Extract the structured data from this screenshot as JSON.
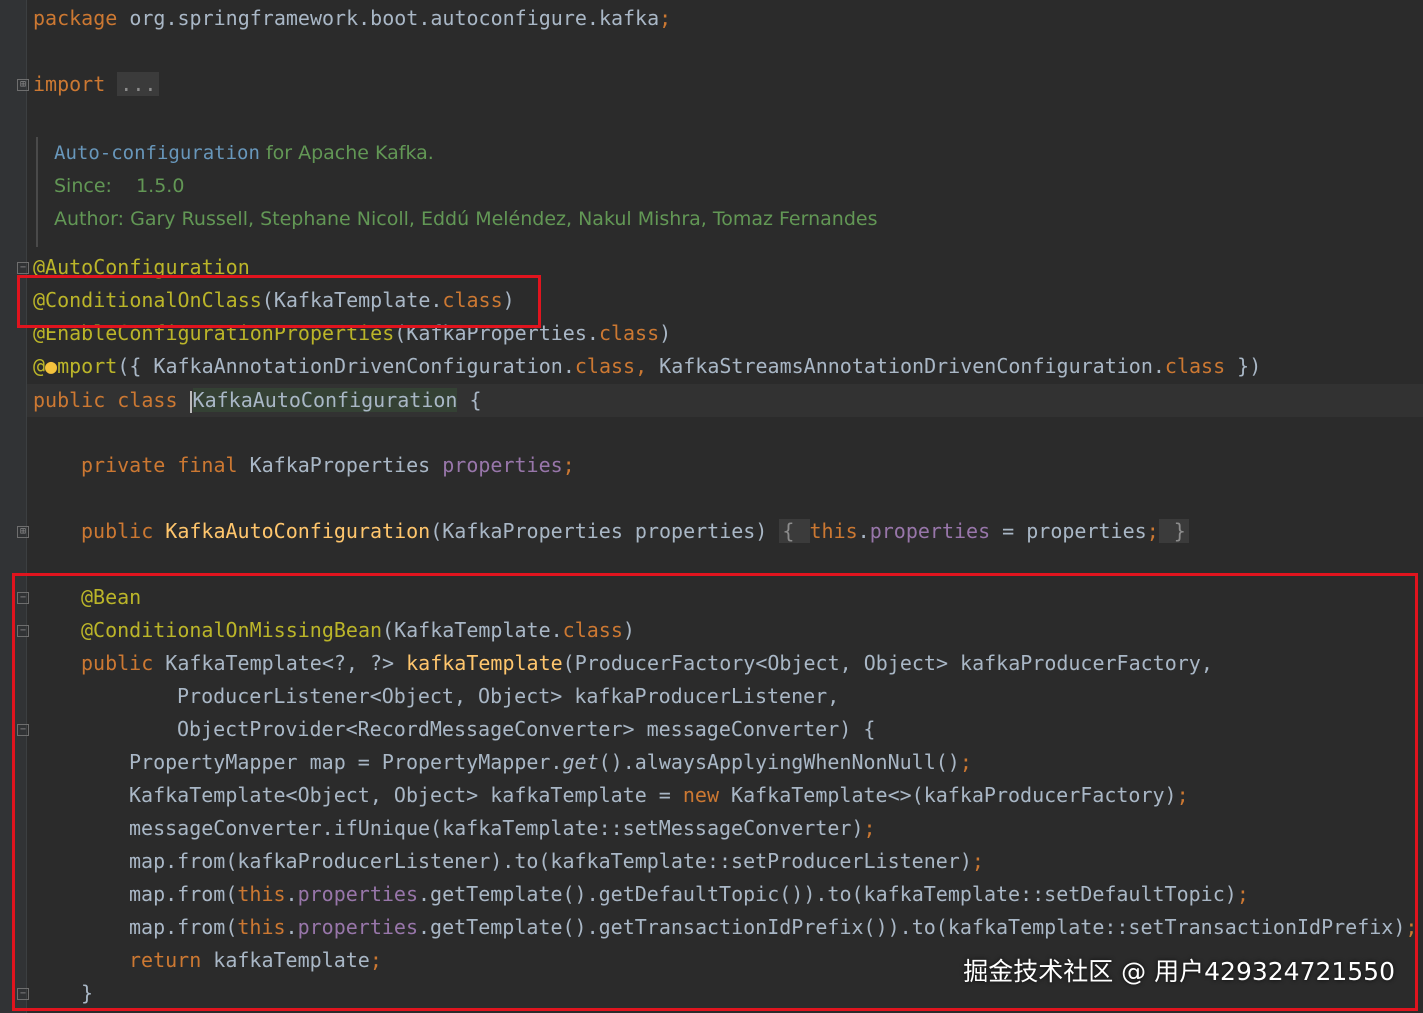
{
  "code": {
    "package_line": {
      "kw": "package",
      "name": " org.springframework.boot.autoconfigure.kafka",
      "semi": ";"
    },
    "import_line": {
      "kw": "import",
      "folded": "..."
    },
    "javadoc": {
      "summary_link": "Auto-configuration",
      "summary_rest": " for Apache Kafka.",
      "since_label": "Since:",
      "since_value": "1.5.0",
      "author_label": "Author:",
      "author_value": "Gary Russell, Stephane Nicoll, Eddú Meléndez, Nakul Mishra, Tomaz Fernandes"
    },
    "ann_autoconfig": "@AutoConfiguration",
    "ann_conditional": {
      "ann": "@ConditionalOnClass",
      "open": "(KafkaTemplate.",
      "kw": "class",
      "close": ")"
    },
    "ann_enable": {
      "ann": "@EnableConfigurationProperties",
      "open": "(KafkaProperties.",
      "kw": "class",
      "close": ")"
    },
    "ann_import": {
      "at": "@",
      "ann_rest": "mport",
      "p1": "({ KafkaAnnotationDrivenConfiguration.",
      "kw1": "class",
      "comma": ",",
      "p2": " KafkaStreamsAnnotationDrivenConfiguration.",
      "kw2": "class",
      "close": " })"
    },
    "class_decl": {
      "kw": "public class ",
      "name": "KafkaAutoConfiguration",
      "brace": " {"
    },
    "field_line": {
      "kw": "private final ",
      "type": "KafkaProperties ",
      "name": "properties",
      "semi": ";"
    },
    "ctor_line": {
      "kw": "public ",
      "name": "KafkaAutoConfiguration",
      "params": "(KafkaProperties properties) ",
      "body_open": "{ ",
      "this_kw": "this",
      "dot": ".",
      "field": "properties",
      "assign": " = properties",
      "semi": ";",
      "body_close": " }"
    },
    "bean_ann": "@Bean",
    "missing_bean": {
      "ann": "@ConditionalOnMissingBean",
      "open": "(KafkaTemplate.",
      "kw": "class",
      "close": ")"
    },
    "method_decl": {
      "kw": "public ",
      "ret": "KafkaTemplate<?, ?> ",
      "name": "kafkaTemplate",
      "params": "(ProducerFactory<Object, Object> kafkaProducerFactory,"
    },
    "method_param2": "ProducerListener<Object, Object> kafkaProducerListener,",
    "method_param3": "ObjectProvider<RecordMessageConverter> messageConverter) {",
    "body1": {
      "pre": "PropertyMapper map = PropertyMapper.",
      "ital": "get",
      "post": "().alwaysApplyingWhenNonNull()",
      "semi": ";"
    },
    "body2": {
      "pre": "KafkaTemplate<Object, Object> kafkaTemplate = ",
      "kw": "new",
      "post": " KafkaTemplate<>(kafkaProducerFactory)",
      "semi": ";"
    },
    "body3": {
      "pre": "messageConverter.ifUnique(kafkaTemplate::setMessageConverter)",
      "semi": ";"
    },
    "body4": {
      "pre": "map.from(kafkaProducerListener).to(kafkaTemplate::setProducerListener)",
      "semi": ";"
    },
    "body5": {
      "pre": "map.from(",
      "kw": "this",
      "dot": ".",
      "field": "properties",
      "post": ".getTemplate().getDefaultTopic()).to(kafkaTemplate::setDefaultTopic)",
      "semi": ";"
    },
    "body6": {
      "pre": "map.from(",
      "kw": "this",
      "dot": ".",
      "field": "properties",
      "post": ".getTemplate().getTransactionIdPrefix()).to(kafkaTemplate::setTransactionIdPrefix)",
      "semi": ";"
    },
    "body7": {
      "kw": "return",
      "post": " kafkaTemplate",
      "semi": ";"
    },
    "closing_brace": "}"
  },
  "watermark": "掘金技术社区 @ 用户429324721550",
  "colors": {
    "background": "#2b2b2b",
    "keyword": "#cc7832",
    "annotation": "#bbb529",
    "field": "#9876aa",
    "method": "#ffc66d",
    "doc": "#629755",
    "highlight_box": "#e0141e"
  }
}
